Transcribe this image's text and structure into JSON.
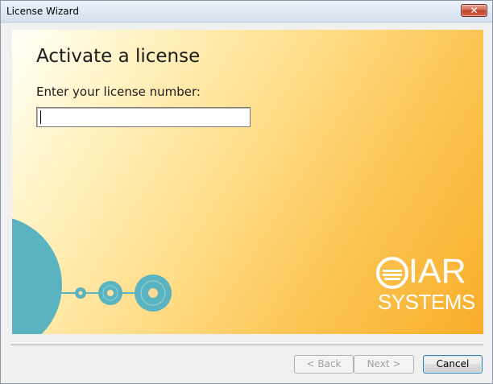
{
  "window": {
    "title": "License Wizard",
    "close_icon": "close-icon"
  },
  "content": {
    "heading": "Activate a license",
    "field_label": "Enter your license number:",
    "license_value": "",
    "colors": {
      "gradient_start": "#fffff7",
      "gradient_end": "#f8ae2a",
      "art_teal": "#5ab3c0"
    }
  },
  "logo": {
    "name": "IAR",
    "subtitle": "SYSTEMS",
    "mark_icon": "iar-logo-mark-icon"
  },
  "buttons": {
    "back_label": "< Back",
    "next_label": "Next >",
    "cancel_label": "Cancel",
    "back_enabled": false,
    "next_enabled": false
  }
}
